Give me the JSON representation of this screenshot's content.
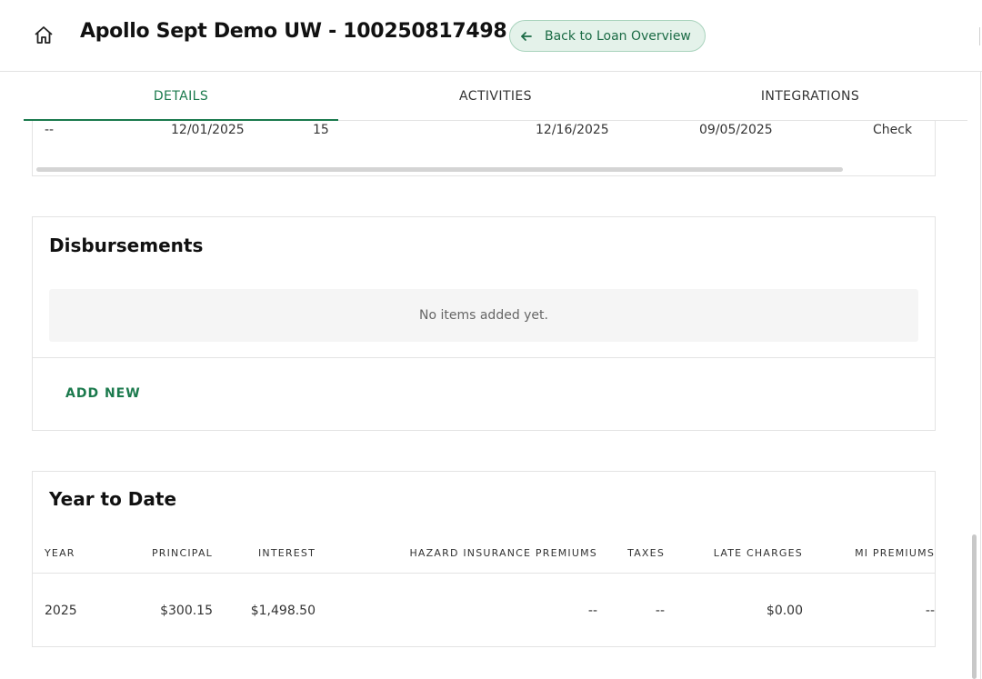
{
  "header": {
    "title": "Apollo Sept Demo UW - 100250817498",
    "back_label": "Back to Loan Overview",
    "home_icon": "home-icon",
    "back_icon": "arrow-left-icon"
  },
  "tabs": [
    {
      "label": "DETAILS",
      "active": true
    },
    {
      "label": "ACTIVITIES",
      "active": false
    },
    {
      "label": "INTEGRATIONS",
      "active": false
    }
  ],
  "top_table": {
    "row": [
      "--",
      "12/01/2025",
      "15",
      "12/16/2025",
      "09/05/2025",
      "Check"
    ]
  },
  "disbursements": {
    "title": "Disbursements",
    "empty_text": "No items added yet.",
    "add_label": "ADD NEW"
  },
  "year_to_date": {
    "title": "Year to Date",
    "headers": [
      "YEAR",
      "PRINCIPAL",
      "INTEREST",
      "HAZARD INSURANCE PREMIUMS",
      "TAXES",
      "LATE CHARGES",
      "MI PREMIUMS"
    ],
    "rows": [
      [
        "2025",
        "$300.15",
        "$1,498.50",
        "--",
        "--",
        "$0.00",
        "--"
      ]
    ]
  },
  "colors": {
    "accent": "#1b7a4d",
    "back_button_bg": "#e4f2ea",
    "empty_bg": "#f5f5f5",
    "border": "#e3e3e3"
  }
}
